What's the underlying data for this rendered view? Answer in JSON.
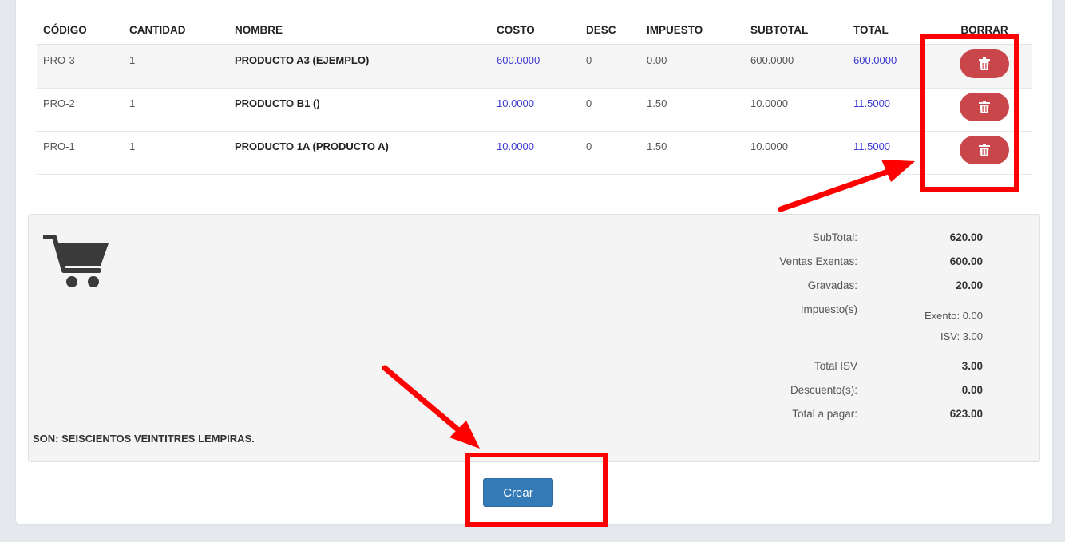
{
  "table": {
    "headers": [
      "CÓDIGO",
      "CANTIDAD",
      "NOMBRE",
      "COSTO",
      "DESC",
      "IMPUESTO",
      "SUBTOTAL",
      "TOTAL",
      "BORRAR"
    ],
    "rows": [
      {
        "code": "PRO-3",
        "qty": "1",
        "name": "PRODUCTO A3 (EJEMPLO)",
        "cost": "600.0000",
        "desc": "0",
        "tax": "0.00",
        "subtotal": "600.0000",
        "total": "600.0000"
      },
      {
        "code": "PRO-2",
        "qty": "1",
        "name": "PRODUCTO B1 ()",
        "cost": "10.0000",
        "desc": "0",
        "tax": "1.50",
        "subtotal": "10.0000",
        "total": "11.5000"
      },
      {
        "code": "PRO-1",
        "qty": "1",
        "name": "PRODUCTO 1A (PRODUCTO A)",
        "cost": "10.0000",
        "desc": "0",
        "tax": "1.50",
        "subtotal": "10.0000",
        "total": "11.5000"
      }
    ]
  },
  "summary": {
    "subtotal_label": "SubTotal:",
    "subtotal_value": "620.00",
    "exentas_label": "Ventas Exentas:",
    "exentas_value": "600.00",
    "gravadas_label": "Gravadas:",
    "gravadas_value": "20.00",
    "impuestos_label": "Impuesto(s)",
    "exento_line": "Exento: 0.00",
    "isv_line": "ISV: 3.00",
    "total_isv_label": "Total ISV",
    "total_isv_value": "3.00",
    "descuento_label": "Descuento(s):",
    "descuento_value": "0.00",
    "total_label": "Total a pagar:",
    "total_value": "623.00",
    "amount_words": "SON: SEISCIENTOS VEINTITRES LEMPIRAS."
  },
  "actions": {
    "create_label": "Crear"
  },
  "icons": {
    "cart": "shopping-cart-icon",
    "delete": "trash-icon"
  },
  "colors": {
    "delete_button": "#c9474b",
    "primary_button": "#337ab7",
    "link_value": "#3a3ad6",
    "annotation": "#ff0000"
  }
}
